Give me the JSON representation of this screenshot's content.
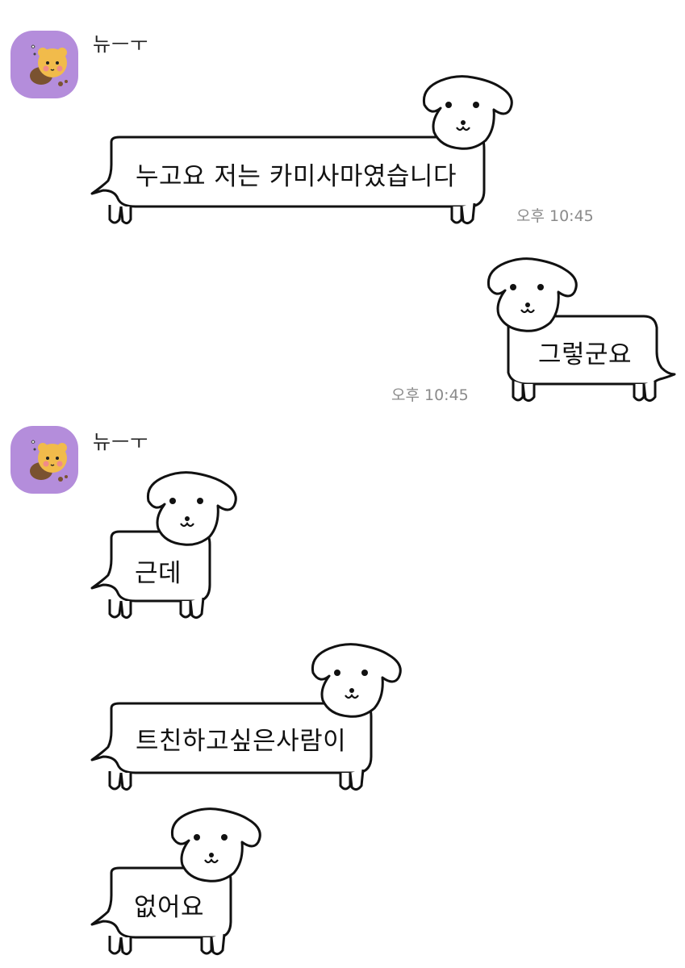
{
  "chat": {
    "sender_name": "뉴ㅡㅜ",
    "messages": [
      {
        "from": "other",
        "text": "누고요 저는 카미사마였습니다",
        "time": "오후 10:45"
      },
      {
        "from": "me",
        "text": "그렇군요",
        "time": "오후 10:45"
      },
      {
        "from": "other",
        "text": "근데"
      },
      {
        "from": "other",
        "text": "트친하고싶은사람이"
      },
      {
        "from": "other",
        "text": "없어요"
      }
    ]
  },
  "colors": {
    "avatar_bg": "#b48ddb",
    "bubble_stroke": "#111111",
    "bubble_fill": "#ffffff",
    "timestamp": "#8a8a8a"
  },
  "icons": {
    "avatar": "bear-sticker-icon",
    "bubble": "dog-bubble-icon"
  }
}
